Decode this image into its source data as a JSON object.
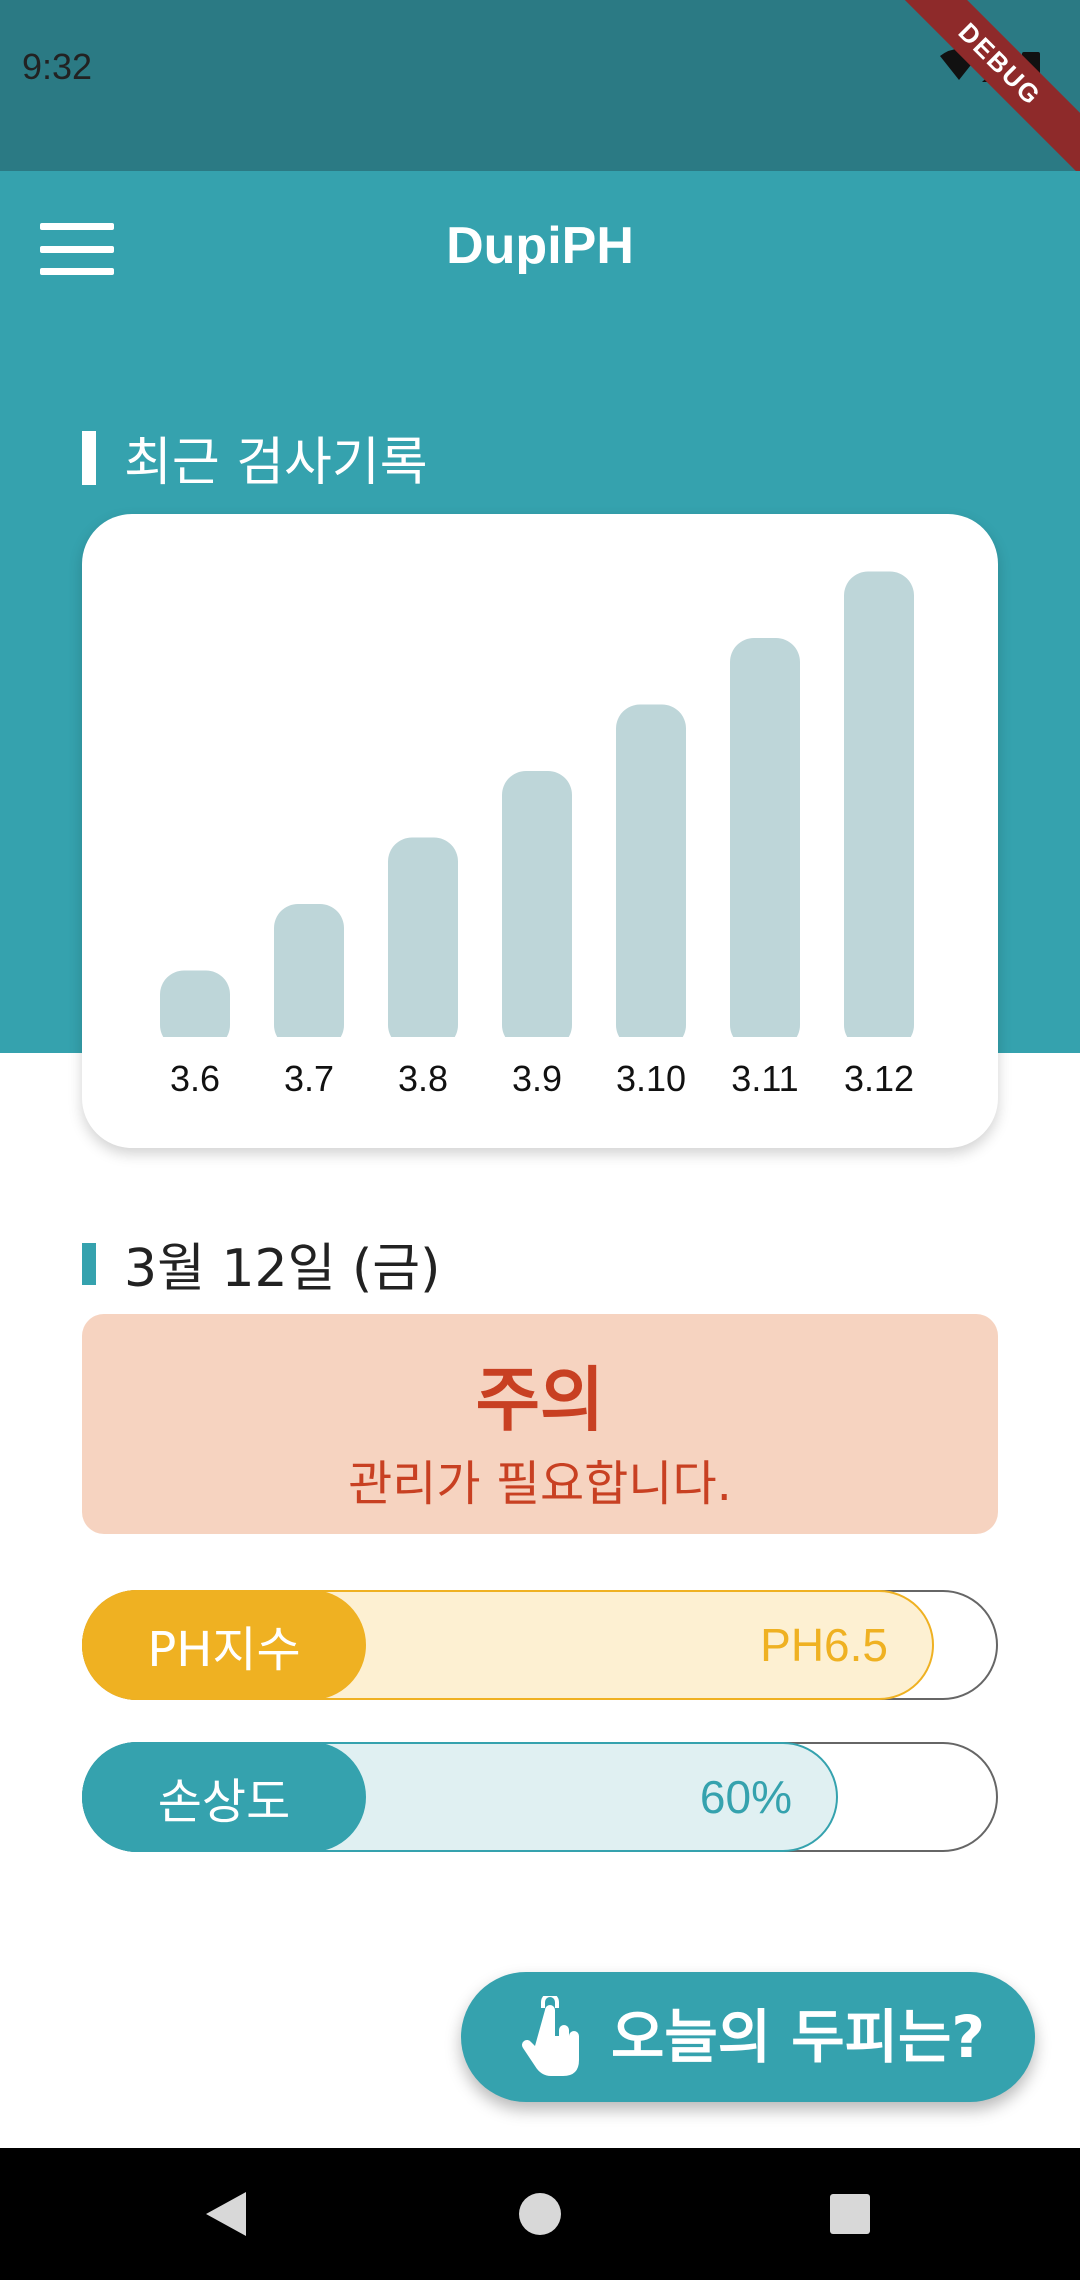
{
  "status_bar": {
    "time": "9:32",
    "debug_label": "DEBUG"
  },
  "app_bar": {
    "title": "DupiPH",
    "menu_icon": "menu-icon"
  },
  "recent": {
    "title": "최근 검사기록",
    "chart_data": {
      "type": "bar",
      "categories": [
        "3.6",
        "3.7",
        "3.8",
        "3.9",
        "3.10",
        "3.11",
        "3.12"
      ],
      "values": [
        1,
        2,
        3,
        4,
        5,
        6,
        7
      ],
      "color": "#bed6d9"
    }
  },
  "today": {
    "date": "3월 12일 (금)",
    "status_heading": "주의",
    "status_message": "관리가 필요합니다.",
    "status_bg": "#f6d3c0",
    "status_color": "#c84022"
  },
  "meters": {
    "ph": {
      "label": "PH지수",
      "value": "PH6.5",
      "fill_fraction": 0.93,
      "color": "#efb122"
    },
    "damage": {
      "label": "손상도",
      "value": "60%",
      "fill_fraction": 0.825,
      "color": "#35a2ae"
    }
  },
  "cta": {
    "label": "오늘의 두피는?",
    "icon": "touch-hand-icon"
  },
  "nav": {
    "back_icon": "back-icon",
    "home_icon": "home-icon",
    "recent_icon": "recent-apps-icon"
  },
  "colors": {
    "primary": "#35a2ae",
    "status_bar": "#2b7a84"
  }
}
